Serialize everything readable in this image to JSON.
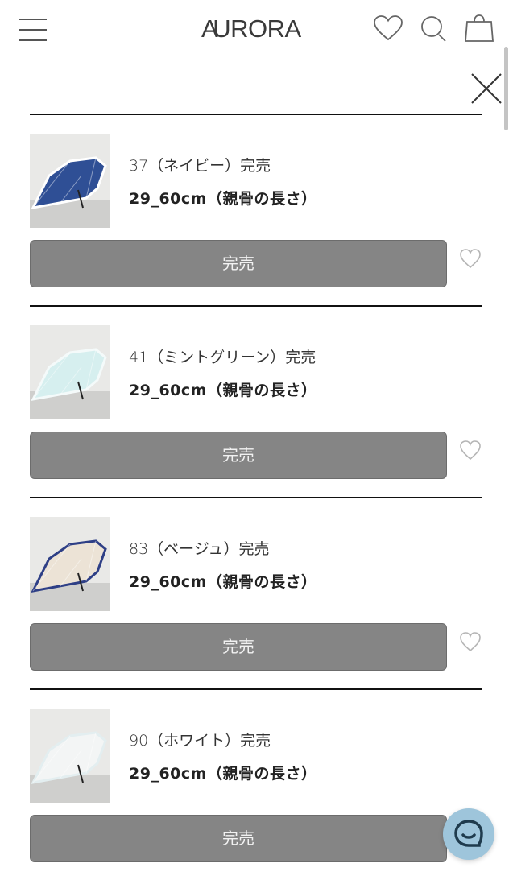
{
  "header": {
    "brand_initial": "A",
    "brand_rest": "URORA",
    "menu_icon": "hamburger-menu-icon",
    "wishlist_icon": "heart-icon",
    "search_icon": "search-icon",
    "cart_icon": "shopping-bag-icon"
  },
  "panel": {
    "close_icon": "close-icon"
  },
  "items": [
    {
      "variant": "37（ネイビー）完売",
      "size": "29_60cm（親骨の長さ）",
      "button": "完売",
      "umbrella_color": "#2f4f95",
      "trim_color": "#ffffff"
    },
    {
      "variant": "41（ミントグリーン）完売",
      "size": "29_60cm（親骨の長さ）",
      "button": "完売",
      "umbrella_color": "#d6efef",
      "trim_color": "#f4fafa"
    },
    {
      "variant": "83（ベージュ）完売",
      "size": "29_60cm（親骨の長さ）",
      "button": "完売",
      "umbrella_color": "#ece3d6",
      "trim_color": "#2e3f86"
    },
    {
      "variant": "90（ホワイト）完売",
      "size": "29_60cm（親骨の長さ）",
      "button": "完売",
      "umbrella_color": "#f3f5f5",
      "trim_color": "#e3eef0"
    }
  ],
  "chat": {
    "icon": "chat-bubble-icon",
    "color": "#9ec5db"
  }
}
